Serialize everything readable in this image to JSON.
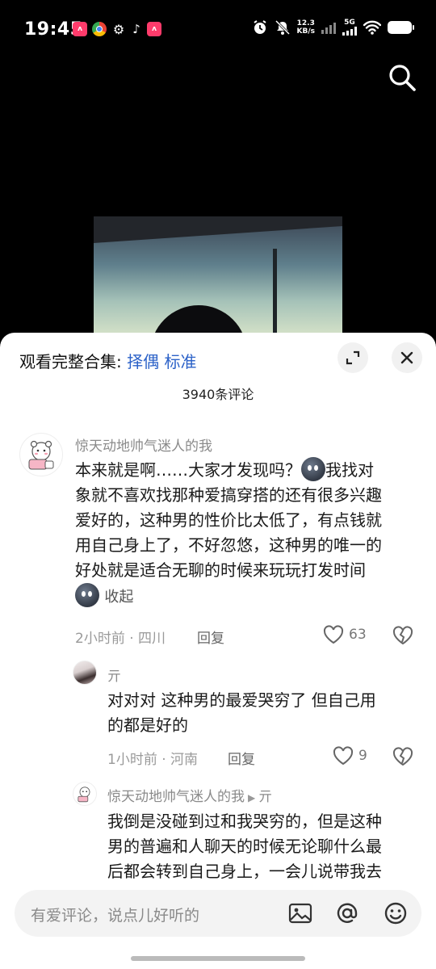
{
  "status_bar": {
    "time": "19:45",
    "net_speed_value": "12.3",
    "net_speed_unit": "KB/s",
    "network": "5G",
    "icons": [
      "alarm-icon",
      "mute-icon",
      "signal-icon",
      "wifi-icon",
      "battery-icon"
    ]
  },
  "sheet": {
    "header_prefix": "观看完整合集:",
    "header_link": "择偶 标准",
    "comment_count": "3940条评论"
  },
  "comments": [
    {
      "username": "惊天动地帅气迷人的我",
      "lines": [
        "本来就是啊……大家才发现吗？",
        "我找对",
        "象就不喜欢找那种爱搞穿搭的还有很多兴趣",
        "爱好的，这种男的性价比太低了，有点钱就",
        "用自己身上了，不好忽悠，这种男的唯一的",
        "好处就是适合无聊的时候来玩玩打发时间"
      ],
      "collapse": "收起",
      "meta": "2小时前 · 四川",
      "reply": "回复",
      "likes": "63"
    },
    {
      "username": "亓",
      "lines": [
        "对对对 这种男的最爱哭穷了 但自己用",
        "的都是好的"
      ],
      "meta": "1小时前 · 河南",
      "reply": "回复",
      "likes": "9"
    },
    {
      "username": "惊天动地帅气迷人的我",
      "reply_to": "亓",
      "lines": [
        "我倒是没碰到过和我哭穷的，但是这种",
        "男的普遍和人聊天的时候无论聊什么最",
        "后都会转到自己身上，一会儿说带我去"
      ]
    }
  ],
  "input": {
    "placeholder": "有爱评论，说点儿好听的"
  }
}
